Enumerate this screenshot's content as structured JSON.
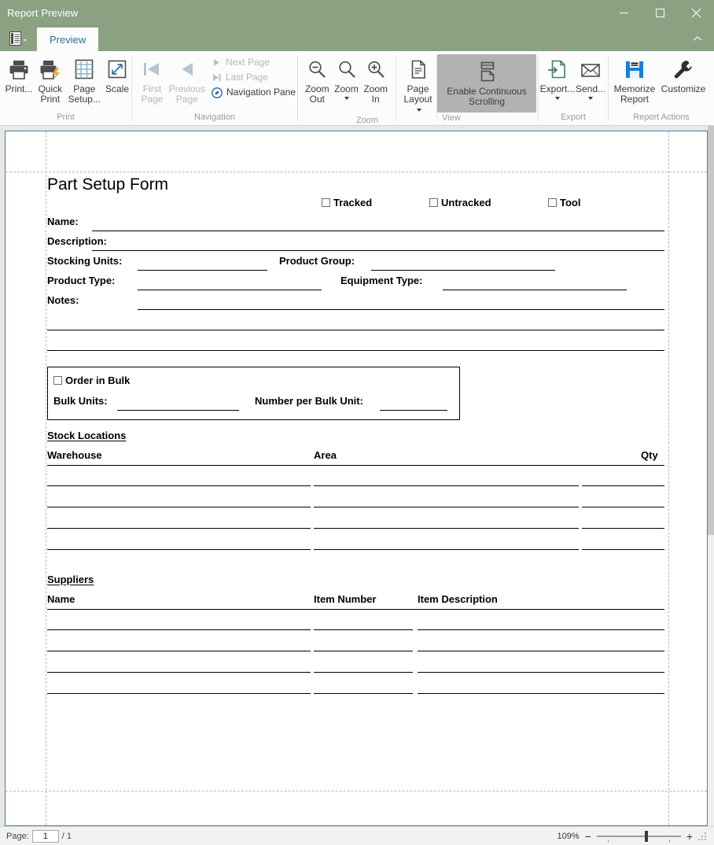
{
  "window": {
    "title": "Report Preview",
    "minimize_icon": "minimize-icon",
    "maximize_icon": "maximize-icon",
    "close_icon": "close-icon"
  },
  "tabs": {
    "app_menu_icon": "report-menu-icon",
    "items": [
      {
        "label": "Preview",
        "active": true
      }
    ],
    "collapse_icon": "chevron-up-icon"
  },
  "ribbon": {
    "groups": [
      {
        "name": "print",
        "label": "Print",
        "buttons": [
          {
            "label": "Print...",
            "icon": "printer-icon",
            "enabled": true
          },
          {
            "label": "Quick\nPrint",
            "line1": "Quick",
            "line2": "Print",
            "icon": "quick-print-icon",
            "enabled": true
          },
          {
            "label": "Page\nSetup...",
            "line1": "Page",
            "line2": "Setup...",
            "icon": "page-setup-icon",
            "enabled": true
          },
          {
            "label": "Scale",
            "icon": "scale-icon",
            "enabled": true
          }
        ]
      },
      {
        "name": "navigation",
        "label": "Navigation",
        "buttons": [
          {
            "line1": "First",
            "line2": "Page",
            "icon": "first-page-icon",
            "enabled": false
          },
          {
            "line1": "Previous",
            "line2": "Page",
            "icon": "previous-page-icon",
            "enabled": false
          },
          {
            "label": "Next Page",
            "icon": "next-page-icon",
            "enabled": false
          },
          {
            "label": "Last Page",
            "icon": "last-page-icon",
            "enabled": false
          },
          {
            "label": "Navigation Pane",
            "icon": "navigation-pane-icon",
            "enabled": true
          }
        ]
      },
      {
        "name": "zoom",
        "label": "Zoom",
        "buttons": [
          {
            "line1": "Zoom",
            "line2": "Out",
            "icon": "zoom-out-icon",
            "enabled": true
          },
          {
            "line1": "Zoom",
            "line2": "",
            "icon": "zoom-icon",
            "enabled": true,
            "dropdown": true
          },
          {
            "line1": "Zoom",
            "line2": "In",
            "icon": "zoom-in-icon",
            "enabled": true
          },
          {
            "line1": "Page",
            "line2": "Layout",
            "icon": "page-layout-icon",
            "enabled": true,
            "dropdown_inline": true
          }
        ]
      },
      {
        "name": "view",
        "label": "View",
        "buttons": [
          {
            "line1": "Enable Continuous",
            "line2": "Scrolling",
            "icon": "continuous-scrolling-icon",
            "enabled": true,
            "active": true
          }
        ]
      },
      {
        "name": "export",
        "label": "Export",
        "buttons": [
          {
            "label": "Export...",
            "icon": "export-icon",
            "enabled": true,
            "dropdown": true
          },
          {
            "label": "Send...",
            "icon": "send-mail-icon",
            "enabled": true,
            "dropdown": true
          }
        ]
      },
      {
        "name": "report-actions",
        "label": "Report Actions",
        "buttons": [
          {
            "line1": "Memorize",
            "line2": "Report",
            "icon": "save-disk-icon",
            "enabled": true
          },
          {
            "label": "Customize",
            "icon": "wrench-icon",
            "enabled": true
          }
        ]
      }
    ]
  },
  "document": {
    "title": "Part Setup Form",
    "checkboxes": [
      {
        "label": "Tracked",
        "checked": false
      },
      {
        "label": "Untracked",
        "checked": false
      },
      {
        "label": "Tool",
        "checked": false
      }
    ],
    "fields": [
      {
        "label": "Name:",
        "value": ""
      },
      {
        "label": "Description:",
        "value": ""
      },
      {
        "label": "Stocking Units:",
        "value": ""
      },
      {
        "label": "Product Group:",
        "value": ""
      },
      {
        "label": "Product Type:",
        "value": ""
      },
      {
        "label": "Equipment Type:",
        "value": ""
      },
      {
        "label": "Notes:",
        "value": ""
      }
    ],
    "bulk": {
      "checkbox_label": "Order in Bulk",
      "checked": false,
      "bulk_units_label": "Bulk Units:",
      "bulk_units_value": "",
      "number_per_bulk_label": "Number per Bulk Unit:",
      "number_per_bulk_value": ""
    },
    "stock_locations": {
      "heading": "Stock Locations",
      "columns": [
        "Warehouse",
        "Area",
        "Qty"
      ],
      "rows": [
        [
          "",
          "",
          ""
        ],
        [
          "",
          "",
          ""
        ],
        [
          "",
          "",
          ""
        ],
        [
          "",
          "",
          ""
        ]
      ]
    },
    "suppliers": {
      "heading": "Suppliers",
      "columns": [
        "Name",
        "Item Number",
        "Item Description"
      ],
      "rows": [
        [
          "",
          "",
          ""
        ],
        [
          "",
          "",
          ""
        ],
        [
          "",
          "",
          ""
        ],
        [
          "",
          "",
          ""
        ]
      ]
    }
  },
  "statusbar": {
    "page_label": "Page:",
    "page_value": "1",
    "page_total": "/ 1",
    "zoom_level": "109%",
    "zoom_out_label": "−",
    "zoom_in_label": "+"
  }
}
